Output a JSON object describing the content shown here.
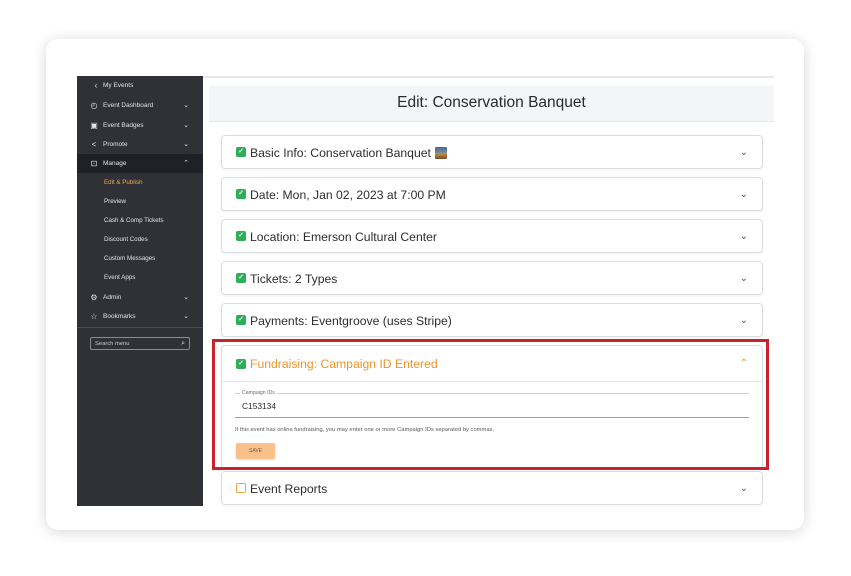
{
  "sidebar": {
    "back_label": "My Events",
    "items": [
      {
        "label": "Event Dashboard",
        "icon": "dashboard-icon"
      },
      {
        "label": "Event Badges",
        "icon": "badge-icon"
      },
      {
        "label": "Promote",
        "icon": "share-icon"
      },
      {
        "label": "Manage",
        "icon": "manage-icon"
      }
    ],
    "manage_sub": [
      "Edit & Publish",
      "Preview",
      "Cash & Comp Tickets",
      "Discount Codes",
      "Custom Messages",
      "Event Apps"
    ],
    "admin_label": "Admin",
    "bookmarks_label": "Bookmarks",
    "search_placeholder": "Search menu"
  },
  "header": {
    "title": "Edit: Conservation Banquet"
  },
  "sections": [
    {
      "title": "Basic Info: Conservation Banquet",
      "status": "complete"
    },
    {
      "title": "Date: Mon, Jan 02, 2023 at 7:00 PM",
      "status": "complete"
    },
    {
      "title": "Location: Emerson Cultural Center",
      "status": "complete"
    },
    {
      "title": "Tickets: 2 Types",
      "status": "complete"
    },
    {
      "title": "Payments: Eventgroove (uses Stripe)",
      "status": "complete"
    }
  ],
  "fundraising": {
    "title": "Fundraising: Campaign ID Entered",
    "field_label": "Campaign IDs",
    "field_value": "C153134",
    "help_text": "If this event has online fundraising, you may enter one or more Campaign IDs separated by commas.",
    "save_label": "SAVE"
  },
  "event_reports": {
    "title": "Event Reports",
    "status": "incomplete"
  },
  "colors": {
    "accent_orange": "#e8952c",
    "check_green": "#2dae57",
    "highlight_red": "#c8232c",
    "sidebar_bg": "#2f3137"
  }
}
